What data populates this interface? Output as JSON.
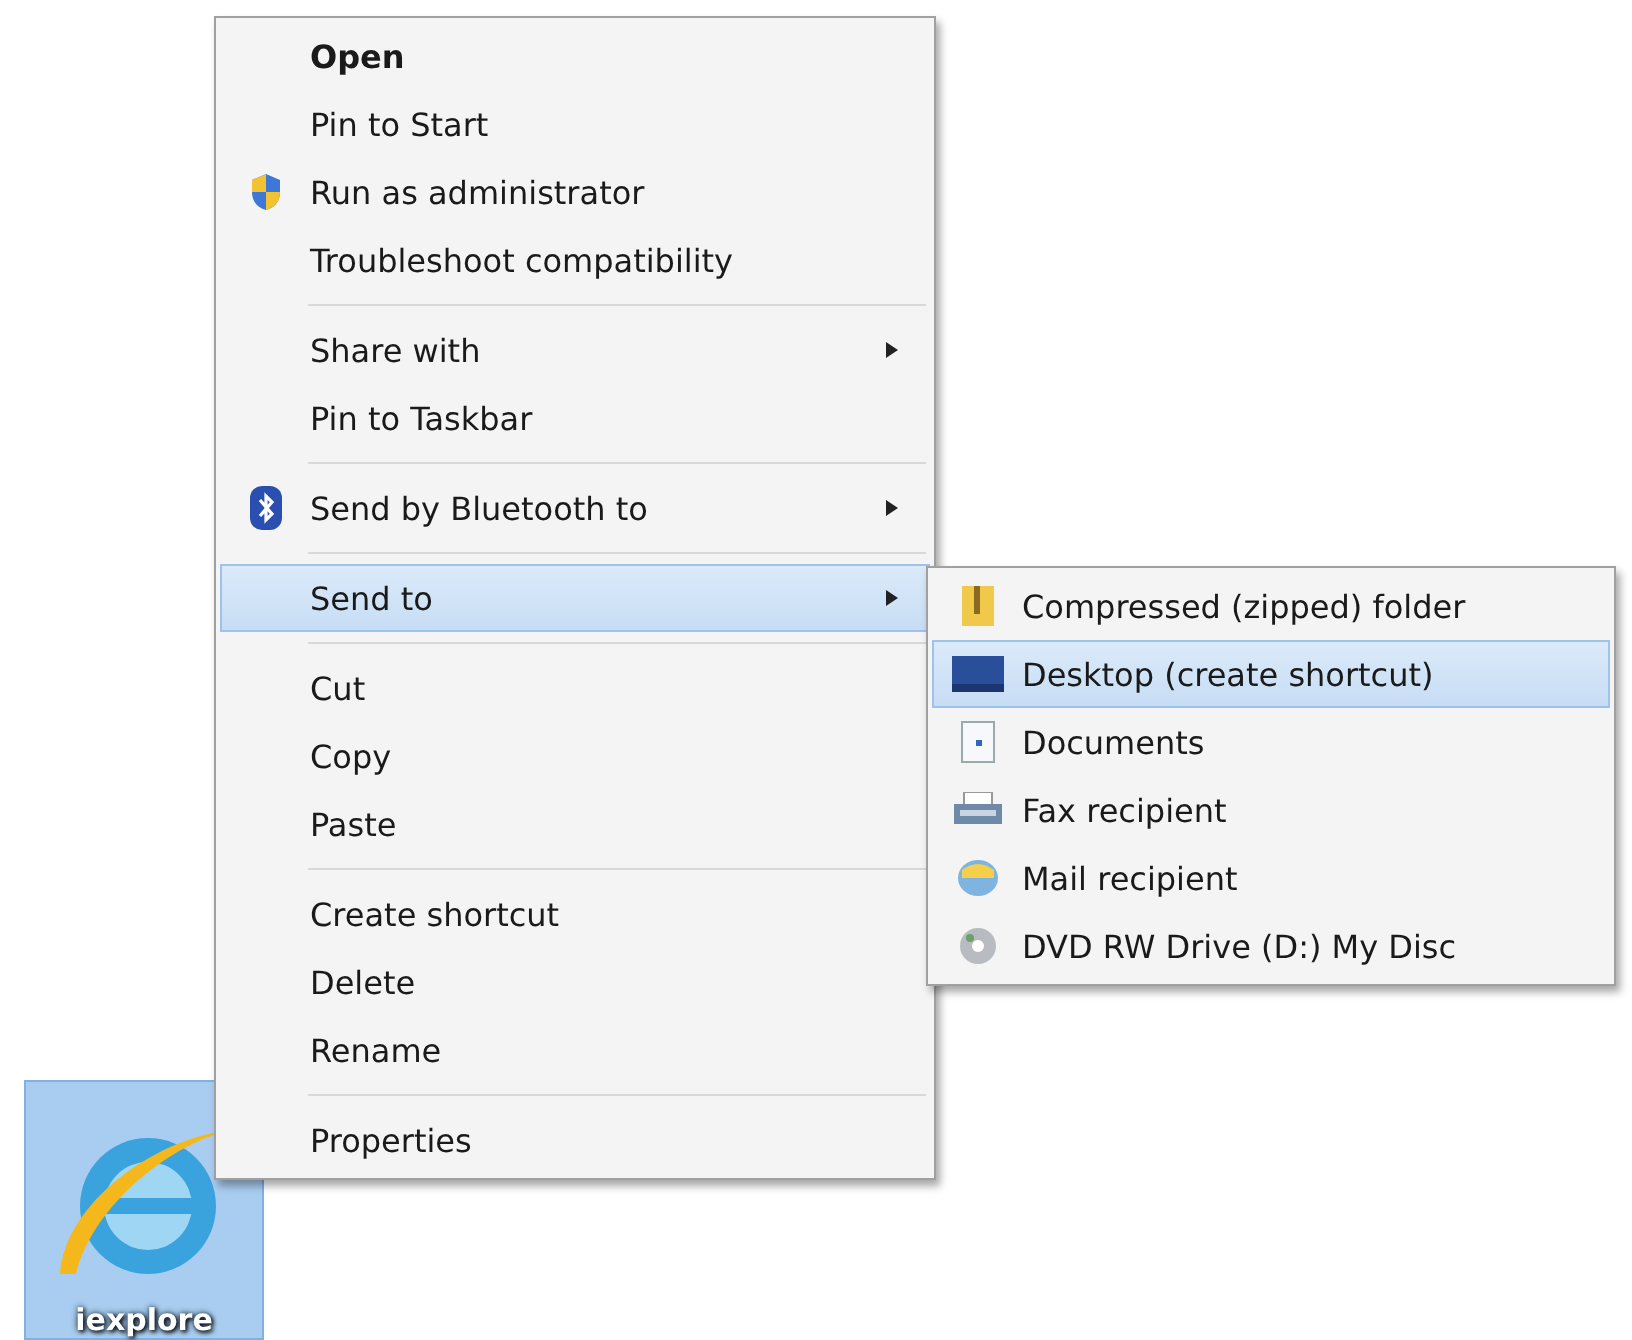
{
  "desktop_icon": {
    "label": "iexplore",
    "selected": true
  },
  "context_menu": {
    "groups": [
      [
        {
          "label": "Open",
          "default": true,
          "kind": "plain",
          "submenu": false,
          "selected": false
        },
        {
          "label": "Pin to Start",
          "default": false,
          "kind": "plain",
          "submenu": false,
          "selected": false
        },
        {
          "label": "Run as administrator",
          "default": false,
          "kind": "shield",
          "submenu": false,
          "selected": false
        },
        {
          "label": "Troubleshoot compatibility",
          "default": false,
          "kind": "plain",
          "submenu": false,
          "selected": false
        }
      ],
      [
        {
          "label": "Share with",
          "default": false,
          "kind": "plain",
          "submenu": true,
          "selected": false
        },
        {
          "label": "Pin to Taskbar",
          "default": false,
          "kind": "plain",
          "submenu": false,
          "selected": false
        }
      ],
      [
        {
          "label": "Send by Bluetooth to",
          "default": false,
          "kind": "bluetooth",
          "submenu": true,
          "selected": false
        }
      ],
      [
        {
          "label": "Send to",
          "default": false,
          "kind": "plain",
          "submenu": true,
          "selected": true
        }
      ],
      [
        {
          "label": "Cut",
          "default": false,
          "kind": "plain",
          "submenu": false,
          "selected": false
        },
        {
          "label": "Copy",
          "default": false,
          "kind": "plain",
          "submenu": false,
          "selected": false
        },
        {
          "label": "Paste",
          "default": false,
          "kind": "plain",
          "submenu": false,
          "selected": false
        }
      ],
      [
        {
          "label": "Create shortcut",
          "default": false,
          "kind": "plain",
          "submenu": false,
          "selected": false
        },
        {
          "label": "Delete",
          "default": false,
          "kind": "plain",
          "submenu": false,
          "selected": false
        },
        {
          "label": "Rename",
          "default": false,
          "kind": "plain",
          "submenu": false,
          "selected": false
        }
      ],
      [
        {
          "label": "Properties",
          "default": false,
          "kind": "plain",
          "submenu": false,
          "selected": false
        }
      ]
    ]
  },
  "send_to_menu": {
    "items": [
      {
        "label": "Compressed (zipped) folder",
        "kind": "zip",
        "selected": false
      },
      {
        "label": "Desktop (create shortcut)",
        "kind": "desktop",
        "selected": true
      },
      {
        "label": "Documents",
        "kind": "documents",
        "selected": false
      },
      {
        "label": "Fax recipient",
        "kind": "fax",
        "selected": false
      },
      {
        "label": "Mail recipient",
        "kind": "mail",
        "selected": false
      },
      {
        "label": "DVD RW Drive (D:) My Disc",
        "kind": "disc",
        "selected": false
      }
    ]
  }
}
